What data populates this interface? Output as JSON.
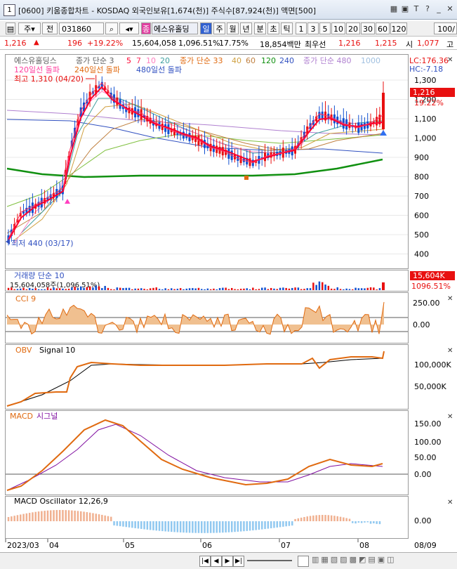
{
  "window": {
    "number": "1",
    "title": "[0600] 키움종합차트 - KOSDAQ 외국인보유[1,674(천)] 주식수[87,924(천)] 액면[500]"
  },
  "toolbar": {
    "period_day": "주",
    "type": "전",
    "code": "031860",
    "stock_icon": "종",
    "stock_name": "에스유홀딩",
    "btn_day": "일",
    "btn_week": "주",
    "btn_month": "월",
    "btn_year": "년",
    "btn_min": "분",
    "btn_sec": "초",
    "btn_tick": "틱",
    "intervals": [
      "1",
      "3",
      "5",
      "10",
      "20",
      "30",
      "60",
      "120"
    ],
    "count": "100/"
  },
  "quote": {
    "price": "1,216",
    "change": "196",
    "change_pct": "+19.22%",
    "volume": "15,604,058",
    "vol_ratio": "1,096.51%",
    "turnover": "17.75%",
    "amount": "18,854백만",
    "preferred": "최우선",
    "bid": "1,216",
    "ask": "1,215",
    "open_label": "시",
    "open": "1,077",
    "high_label": "고"
  },
  "main_panel": {
    "legend_row1": [
      "에스유홀딩스",
      "종가 단순 3",
      "5",
      "7",
      "10",
      "20",
      "종가 단순 33",
      "40",
      "60",
      "120",
      "240",
      "종가 단순 480",
      "1000"
    ],
    "legend_row2": [
      "120일선 돌파",
      "240일선 돌파",
      "480일선 돌파"
    ],
    "lc": "LC:176.36",
    "hc": "HC:-7.18",
    "high_note": "최고 1,310 (04/20)",
    "low_note": "최저 440 (03/17)",
    "price_box": "1,216",
    "pct_box": "19.22%",
    "yticks": [
      "1,300",
      "1,200",
      "1,100",
      "1,000",
      "900",
      "800",
      "700",
      "600",
      "500",
      "400"
    ]
  },
  "volume_panel": {
    "legend": "거래량 단순 10",
    "value": "15,604,058주(1,096.51%)",
    "box1": "15,604K",
    "box2": "1096.51%"
  },
  "cci_panel": {
    "legend": "CCI 9",
    "yticks": [
      "250.00",
      "0.00"
    ]
  },
  "obv_panel": {
    "legend1": "OBV",
    "legend2": "Signal 10",
    "yticks": [
      "100,000K",
      "50,000K"
    ]
  },
  "macd_panel": {
    "legend1": "MACD",
    "legend2": "시그널",
    "yticks": [
      "150.00",
      "100.00",
      "50.00",
      "0.00"
    ]
  },
  "osc_panel": {
    "legend": "MACD Oscillator 12,26,9",
    "yticks": [
      "0.00"
    ]
  },
  "xaxis": {
    "labels": [
      "2023/03",
      "04",
      "05",
      "06",
      "07",
      "08"
    ],
    "right": "08/09"
  },
  "colors": {
    "up": "#e81010",
    "down": "#1050d0",
    "orange": "#e06a10",
    "purple": "#8010a0",
    "green": "#109010",
    "pink": "#ff50a0"
  },
  "chart_data": {
    "type": "line",
    "title": "에스유홀딩스",
    "ylim": [
      380,
      1340
    ],
    "close_approx": [
      440,
      520,
      600,
      640,
      680,
      720,
      1100,
      1250,
      1180,
      1150,
      1120,
      1140,
      1080,
      1050,
      1000,
      980,
      990,
      970,
      950,
      940,
      900,
      880,
      870,
      890,
      900,
      920,
      1050,
      1120,
      1100,
      1080,
      1060,
      1070,
      1216
    ],
    "volume_last": "15,604,058",
    "cci_last": "250.00",
    "obv_last": "100,000K",
    "macd_last": "30.00"
  }
}
